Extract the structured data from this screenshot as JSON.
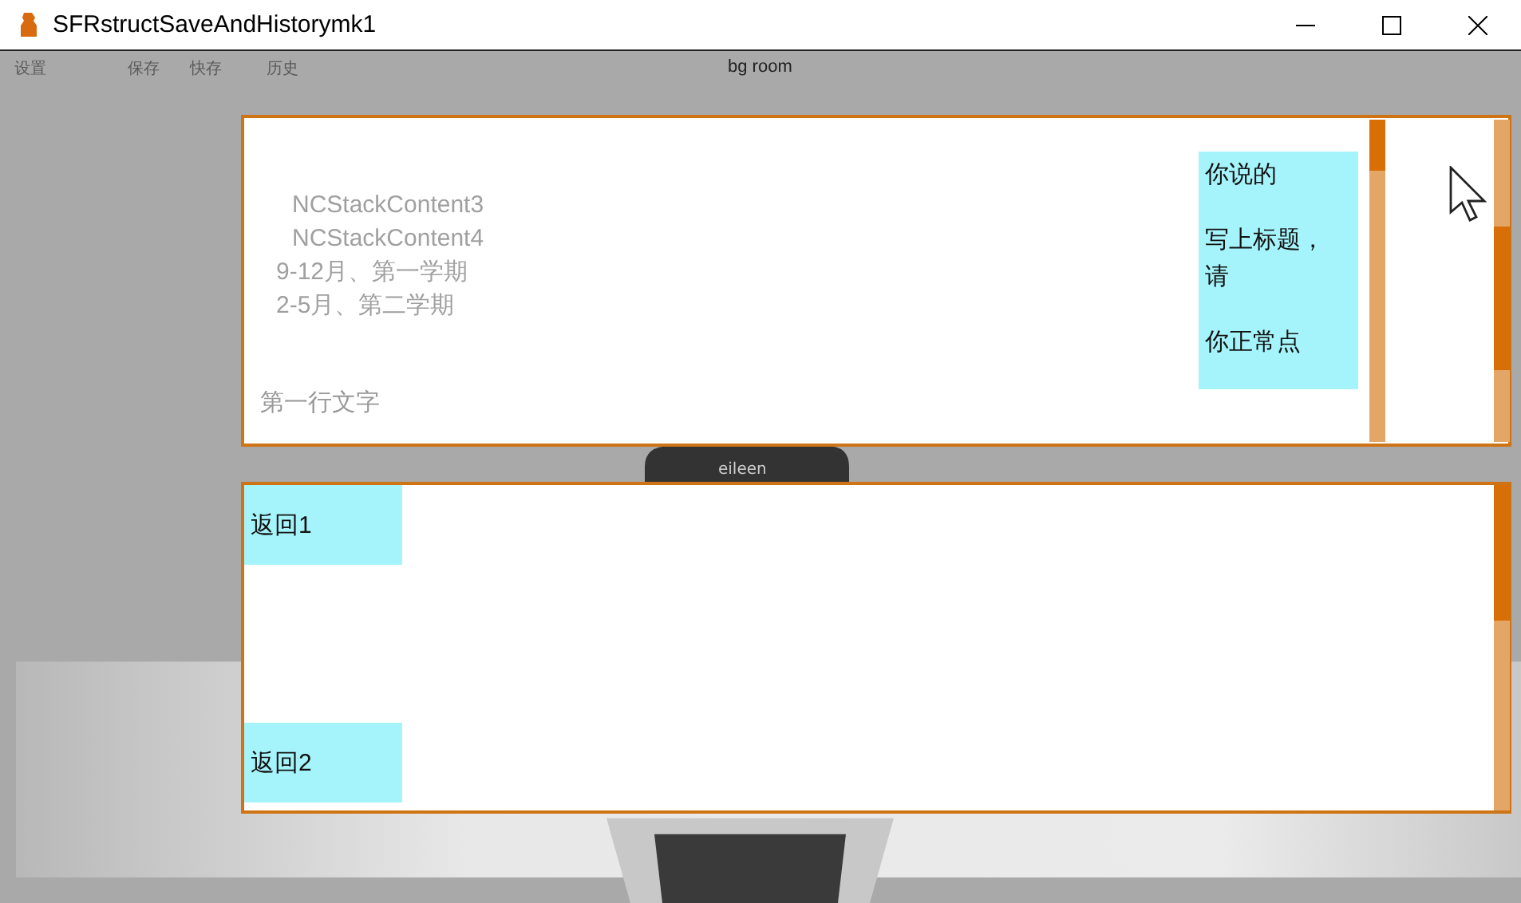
{
  "window": {
    "title": "SFRstructSaveAndHistorymk1"
  },
  "menu": [
    {
      "label": "设置"
    },
    {
      "label": "保存"
    },
    {
      "label": "快存"
    },
    {
      "label": "历史"
    }
  ],
  "scene_label": "bg room",
  "speaker": "eileen",
  "top_panel": {
    "lines": [
      {
        "kind": "stack",
        "text": "NCStackContent3"
      },
      {
        "kind": "stack",
        "text": "NCStackContent4"
      },
      {
        "kind": "term",
        "text": "9-12月、第一学期"
      },
      {
        "kind": "term",
        "text": "2-5月、第二学期"
      }
    ],
    "footer_text": "第一行文字",
    "bubble": [
      "你说的",
      "写上标题，请",
      "你正常点"
    ]
  },
  "bottom_panel": {
    "buttons": [
      {
        "label": "返回1"
      },
      {
        "label": "返回2"
      }
    ]
  }
}
